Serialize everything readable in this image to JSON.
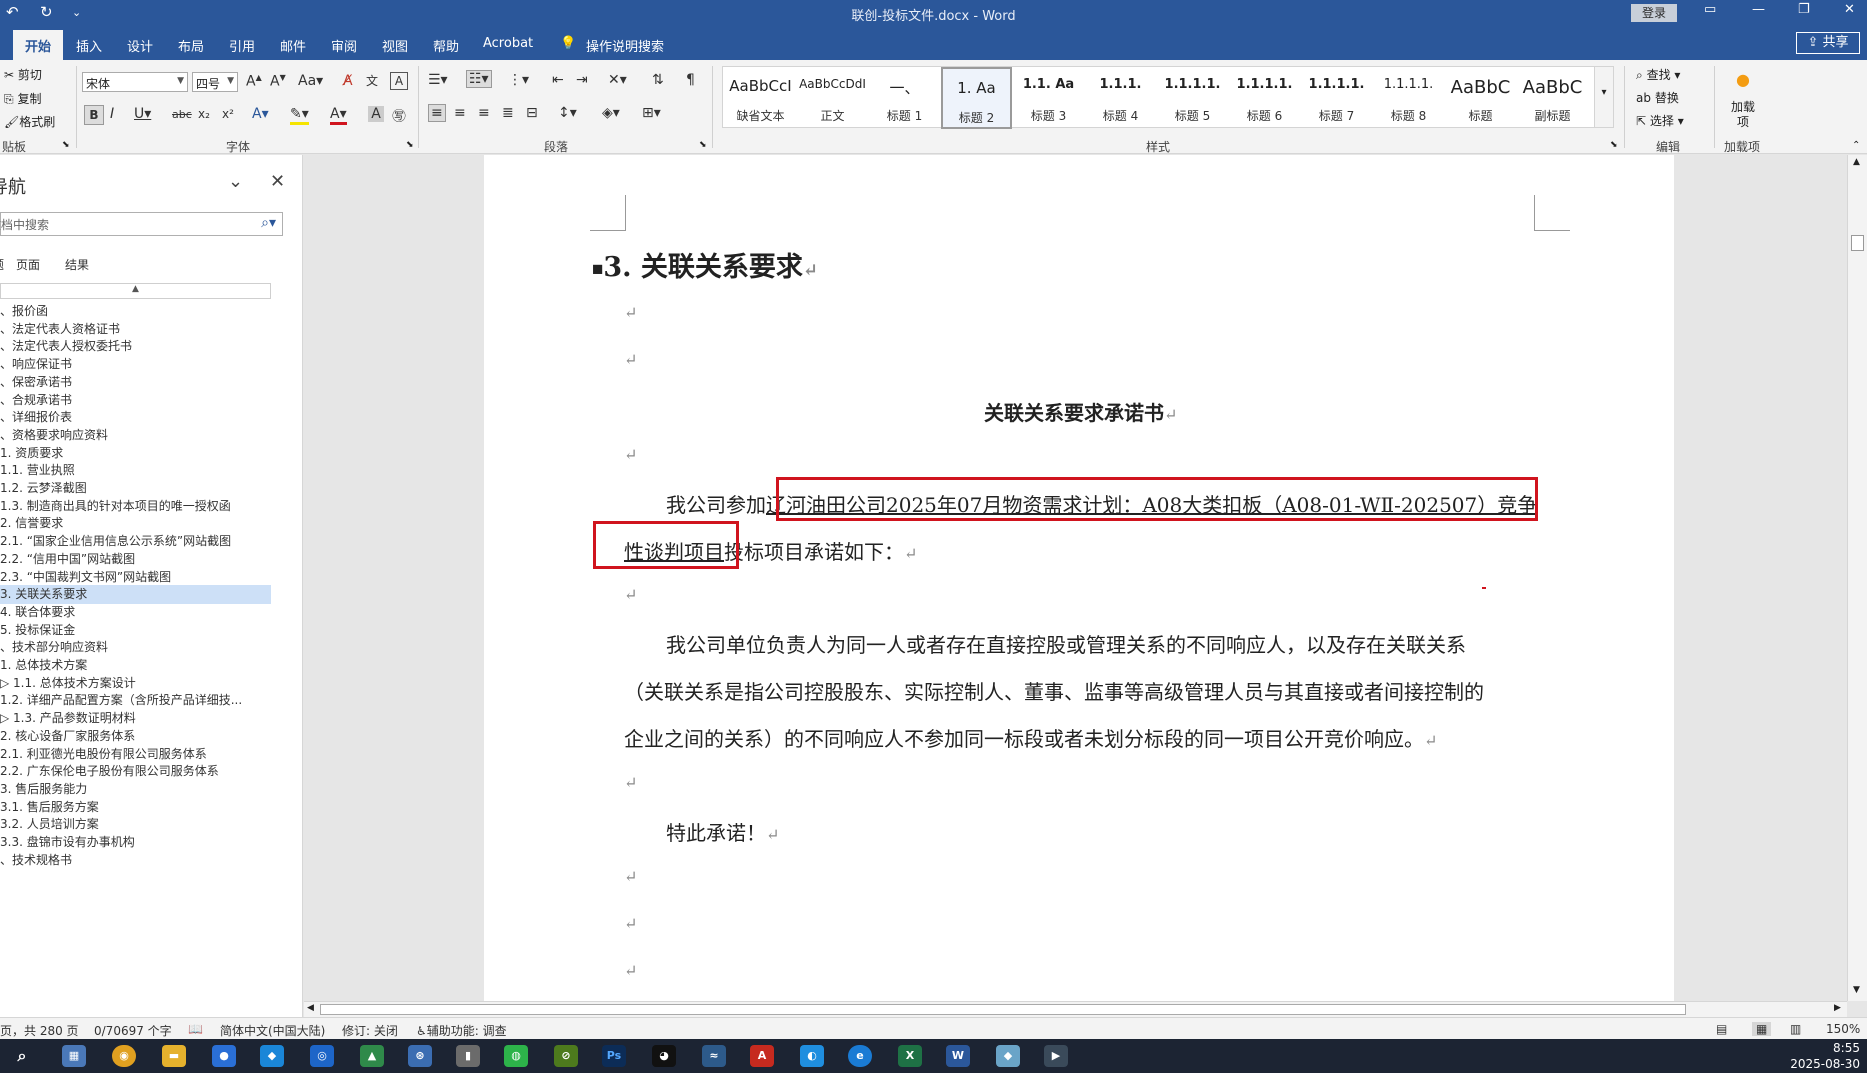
{
  "window": {
    "title": "联创-投标文件.docx - Word",
    "login_label": "登录"
  },
  "quick_access": {
    "undo": "↶",
    "redo": "↻",
    "customize": "⌄"
  },
  "tabs": [
    "开始",
    "插入",
    "设计",
    "布局",
    "引用",
    "邮件",
    "审阅",
    "视图",
    "帮助",
    "Acrobat"
  ],
  "tell_me": "操作说明搜索",
  "share_label": "共享",
  "ribbon": {
    "clipboard": {
      "cut": "剪切",
      "copy": "复制",
      "format_painter": "格式刷",
      "group": "贴板"
    },
    "font": {
      "name": "宋体",
      "size": "四号",
      "group": "字体"
    },
    "paragraph": {
      "group": "段落"
    },
    "styles": {
      "group": "样式",
      "items": [
        {
          "preview": "AaBbCcI",
          "name": "缺省文本"
        },
        {
          "preview": "AaBbCcDdI",
          "name": "正文"
        },
        {
          "preview": "一、",
          "name": "标题 1"
        },
        {
          "preview": "1.   Aa",
          "name": "标题 2"
        },
        {
          "preview": "1.1.  Aa",
          "name": "标题 3"
        },
        {
          "preview": "1.1.1.",
          "name": "标题 4"
        },
        {
          "preview": "1.1.1.1.",
          "name": "标题 5"
        },
        {
          "preview": "1.1.1.1.",
          "name": "标题 6"
        },
        {
          "preview": "1.1.1.1.",
          "name": "标题 7"
        },
        {
          "preview": "1.1.1.1.",
          "name": "标题 8"
        },
        {
          "preview": "AaBbC",
          "name": "标题"
        },
        {
          "preview": "AaBbC",
          "name": "副标题"
        }
      ]
    },
    "editing": {
      "find": "查找",
      "replace": "替换",
      "select": "选择",
      "group": "编辑"
    },
    "addins": {
      "label": "加载项",
      "group": "加载项"
    }
  },
  "nav_pane": {
    "title": "导航",
    "search_placeholder": "在文档中搜索",
    "tabs": [
      "标题",
      "页面",
      "结果"
    ],
    "items": [
      {
        "text": "、报价函",
        "active": false
      },
      {
        "text": "、法定代表人资格证书",
        "active": false
      },
      {
        "text": "、法定代表人授权委托书",
        "active": false
      },
      {
        "text": "、响应保证书",
        "active": false
      },
      {
        "text": "、保密承诺书",
        "active": false
      },
      {
        "text": "、合规承诺书",
        "active": false
      },
      {
        "text": "、详细报价表",
        "active": false
      },
      {
        "text": "、资格要求响应资料",
        "active": false
      },
      {
        "text": "1. 资质要求",
        "active": false
      },
      {
        "text": "    1.1. 营业执照",
        "active": false
      },
      {
        "text": "    1.2. 云梦泽截图",
        "active": false
      },
      {
        "text": "    1.3. 制造商出具的针对本项目的唯一授权函",
        "active": false
      },
      {
        "text": "2. 信誉要求",
        "active": false
      },
      {
        "text": "    2.1. “国家企业信用信息公示系统”网站截图",
        "active": false
      },
      {
        "text": "    2.2. “信用中国”网站截图",
        "active": false
      },
      {
        "text": "    2.3. “中国裁判文书网”网站截图",
        "active": false
      },
      {
        "text": "3. 关联关系要求",
        "active": true
      },
      {
        "text": "4. 联合体要求",
        "active": false
      },
      {
        "text": "5. 投标保证金",
        "active": false
      },
      {
        "text": "、技术部分响应资料",
        "active": false
      },
      {
        "text": "1. 总体技术方案",
        "active": false
      },
      {
        "text": "  ▷ 1.1. 总体技术方案设计",
        "active": false
      },
      {
        "text": "    1.2. 详细产品配置方案（含所投产品详细技...",
        "active": false
      },
      {
        "text": "  ▷ 1.3. 产品参数证明材料",
        "active": false
      },
      {
        "text": "2. 核心设备厂家服务体系",
        "active": false
      },
      {
        "text": "    2.1. 利亚德光电股份有限公司服务体系",
        "active": false
      },
      {
        "text": "    2.2. 广东保伦电子股份有限公司服务体系",
        "active": false
      },
      {
        "text": "3. 售后服务能力",
        "active": false
      },
      {
        "text": "    3.1. 售后服务方案",
        "active": false
      },
      {
        "text": "    3.2. 人员培训方案",
        "active": false
      },
      {
        "text": "    3.3. 盘锦市设有办事机构",
        "active": false
      },
      {
        "text": "、技术规格书",
        "active": false
      }
    ]
  },
  "document": {
    "heading": "3. 关联关系要求",
    "center_title": "关联关系要求承诺书",
    "para1_prefix": "我公司参加",
    "para1_link_line1": "辽河油田公司2025年07月物资需求计划：A08大类扣板（A08-01-WⅡ-202507）竞争",
    "para1_link_line2": "性谈判项目",
    "para1_suffix": "投标项目承诺如下：",
    "para2_line1": "我公司单位负责人为同一人或者存在直接控股或管理关系的不同响应人，以及存在关联关系",
    "para2_line2": "（关联关系是指公司控股股东、实际控制人、董事、监事等高级管理人员与其直接或者间接控制的",
    "para2_line3": "企业之间的关系）的不同响应人不参加同一标段或者未划分标段的同一项目公开竞价响应。",
    "closing": "特此承诺！",
    "pilcrow": "↵",
    "annotation_color": "#d0141e"
  },
  "status_bar": {
    "page": "页，共 280 页",
    "words": "0/70697 个字",
    "language": "简体中文(中国大陆)",
    "track_changes": "修订: 关闭",
    "accessibility": "辅助功能: 调查",
    "zoom": "150%"
  },
  "taskbar": {
    "time": "8:55",
    "date": "2025-08-30"
  }
}
